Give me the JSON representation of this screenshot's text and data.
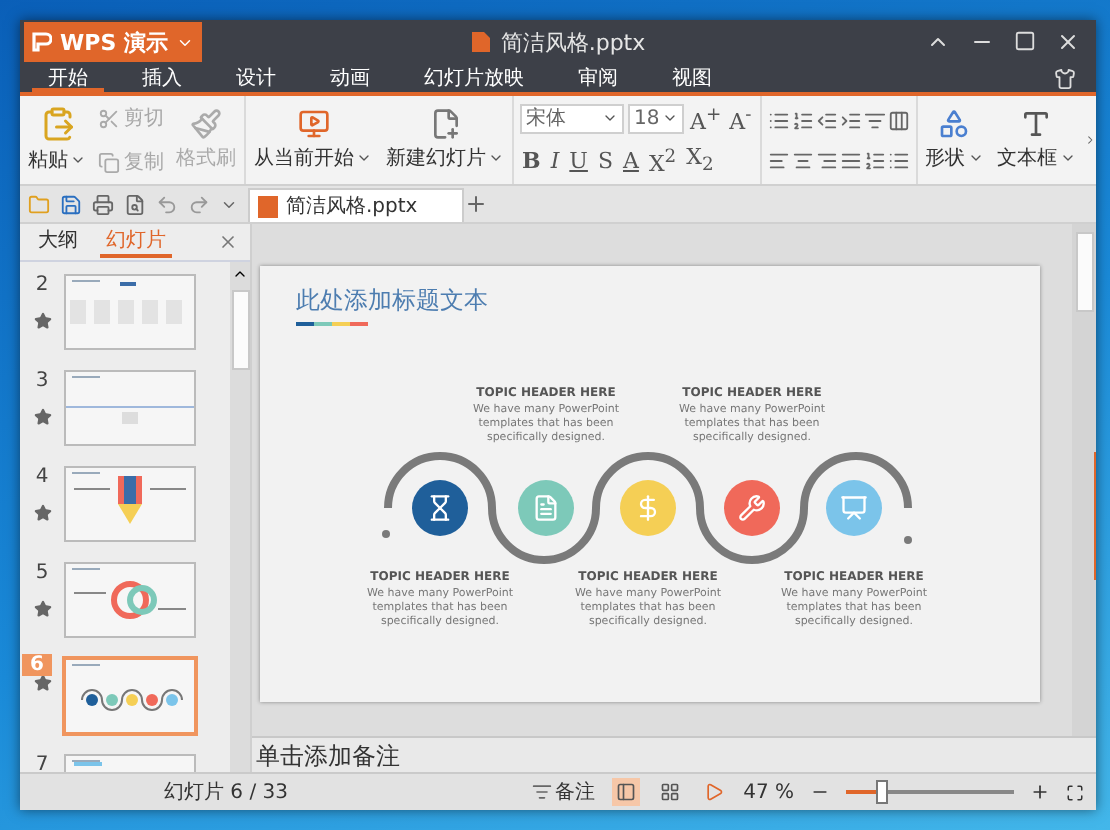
{
  "window": {
    "app_menu": "WPS 演示",
    "title": "简洁风格.pptx"
  },
  "menu_tabs": [
    {
      "label": "开始",
      "selected": true
    },
    {
      "label": "插入",
      "selected": false
    },
    {
      "label": "设计",
      "selected": false
    },
    {
      "label": "动画",
      "selected": false
    },
    {
      "label": "幻灯片放映",
      "selected": false
    },
    {
      "label": "审阅",
      "selected": false
    },
    {
      "label": "视图",
      "selected": false
    }
  ],
  "ribbon": {
    "clipboard": [
      {
        "label": "粘贴",
        "disabled": false
      },
      {
        "label": "剪切",
        "disabled": true
      },
      {
        "label": "复制",
        "disabled": true
      },
      {
        "label": "格式刷",
        "disabled": true
      }
    ],
    "slides": [
      {
        "label": "从当前开始"
      },
      {
        "label": "新建幻灯片"
      }
    ],
    "font": {
      "name": "宋体",
      "size": "18",
      "grow": "A$^{+}$",
      "shrink": "A$^{-}$",
      "styles": [
        "B",
        "I",
        "U",
        "S",
        "A"
      ],
      "superscript": "X$^{2}$",
      "subscript": "X$_{2}$"
    },
    "insert": [
      {
        "label": "形状"
      },
      {
        "label": "文本框"
      }
    ]
  },
  "document_tab": {
    "label": "简洁风格.pptx"
  },
  "side_panel": {
    "tabs": [
      {
        "label": "大纲",
        "selected": false
      },
      {
        "label": "幻灯片",
        "selected": true
      }
    ],
    "slides": [
      {
        "number": "2",
        "selected": false
      },
      {
        "number": "3",
        "selected": false
      },
      {
        "number": "4",
        "selected": false
      },
      {
        "number": "5",
        "selected": false
      },
      {
        "number": "6",
        "selected": true
      },
      {
        "number": "7",
        "selected": false
      }
    ]
  },
  "slide": {
    "title": "此处添加标题文本",
    "topics": [
      {
        "heading": "TOPIC HEADER HERE",
        "body": "We have many PowerPoint templates that has been specifically designed.",
        "color": "#1f5f9a",
        "kind": "below"
      },
      {
        "heading": "TOPIC HEADER HERE",
        "body": "We have many PowerPoint templates that has been specifically designed.",
        "color": "#7dc9b9",
        "kind": "above"
      },
      {
        "heading": "TOPIC HEADER HERE",
        "body": "We have many PowerPoint templates that has been specifically designed.",
        "color": "#f5cf55",
        "kind": "below"
      },
      {
        "heading": "TOPIC HEADER HERE",
        "body": "We have many PowerPoint templates that has been specifically designed.",
        "color": "#f0695a",
        "kind": "above"
      },
      {
        "heading": "TOPIC HEADER HERE",
        "body": "We have many PowerPoint templates that has been specifically designed.",
        "color": "#7bc4ea",
        "kind": "below"
      }
    ]
  },
  "notes": {
    "placeholder": "单击添加备注"
  },
  "status_bar": {
    "slide_counter": "幻灯片 6 / 33",
    "notes_label": "备注",
    "views": [
      {
        "selected": true
      },
      {
        "selected": false
      },
      {
        "selected": false
      }
    ],
    "zoom": "47 %",
    "zoom_slider": {
      "level": 0.22
    }
  }
}
